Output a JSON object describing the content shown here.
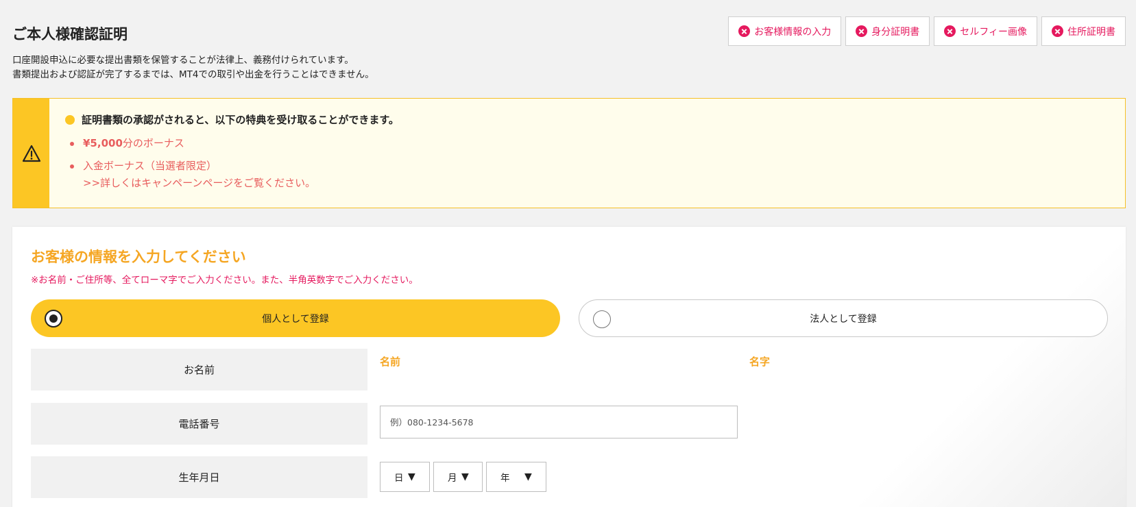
{
  "page": {
    "title": "ご本人様確認証明",
    "intro_line1": "口座開設申込に必要な提出書類を保管することが法律上、義務付けられています。",
    "intro_line2": "書類提出および認証が完了するまでは、MT4での取引や出金を行うことはできません。"
  },
  "status_tabs": [
    {
      "label": "お客様情報の入力",
      "icon": "x-circle-icon",
      "status": "incomplete"
    },
    {
      "label": "身分証明書",
      "icon": "x-circle-icon",
      "status": "incomplete"
    },
    {
      "label": "セルフィー画像",
      "icon": "x-circle-icon",
      "status": "incomplete"
    },
    {
      "label": "住所証明書",
      "icon": "x-circle-icon",
      "status": "incomplete"
    }
  ],
  "notice": {
    "icon": "warning-icon",
    "heading": "証明書類の承認がされると、以下の特典を受け取ることができます。",
    "bonus_amount": "¥5,000",
    "bonus_suffix": "分のボーナス",
    "deposit_bonus": "入金ボーナス（当選者限定）",
    "campaign_link": ">>詳しくはキャンペーンページをご覧ください。"
  },
  "form": {
    "title": "お客様の情報を入力してください",
    "note": "※お名前・ご住所等、全てローマ字でご入力ください。また、半角英数字でご入力ください。",
    "registration_types": [
      {
        "label": "個人として登録",
        "selected": true
      },
      {
        "label": "法人として登録",
        "selected": false
      }
    ],
    "name_label": "お名前",
    "first_name_label": "名前",
    "last_name_label": "名字",
    "phone_label": "電話番号",
    "phone_placeholder": "例）080-1234-5678",
    "birthdate_label": "生年月日",
    "day_select": "日",
    "month_select": "月",
    "year_select": "年",
    "arrow": "▼"
  },
  "colors": {
    "accent_yellow": "#fcc624",
    "title_orange": "#f5a623",
    "error_pink": "#e5195e",
    "benefit_red": "#e85d5d"
  }
}
